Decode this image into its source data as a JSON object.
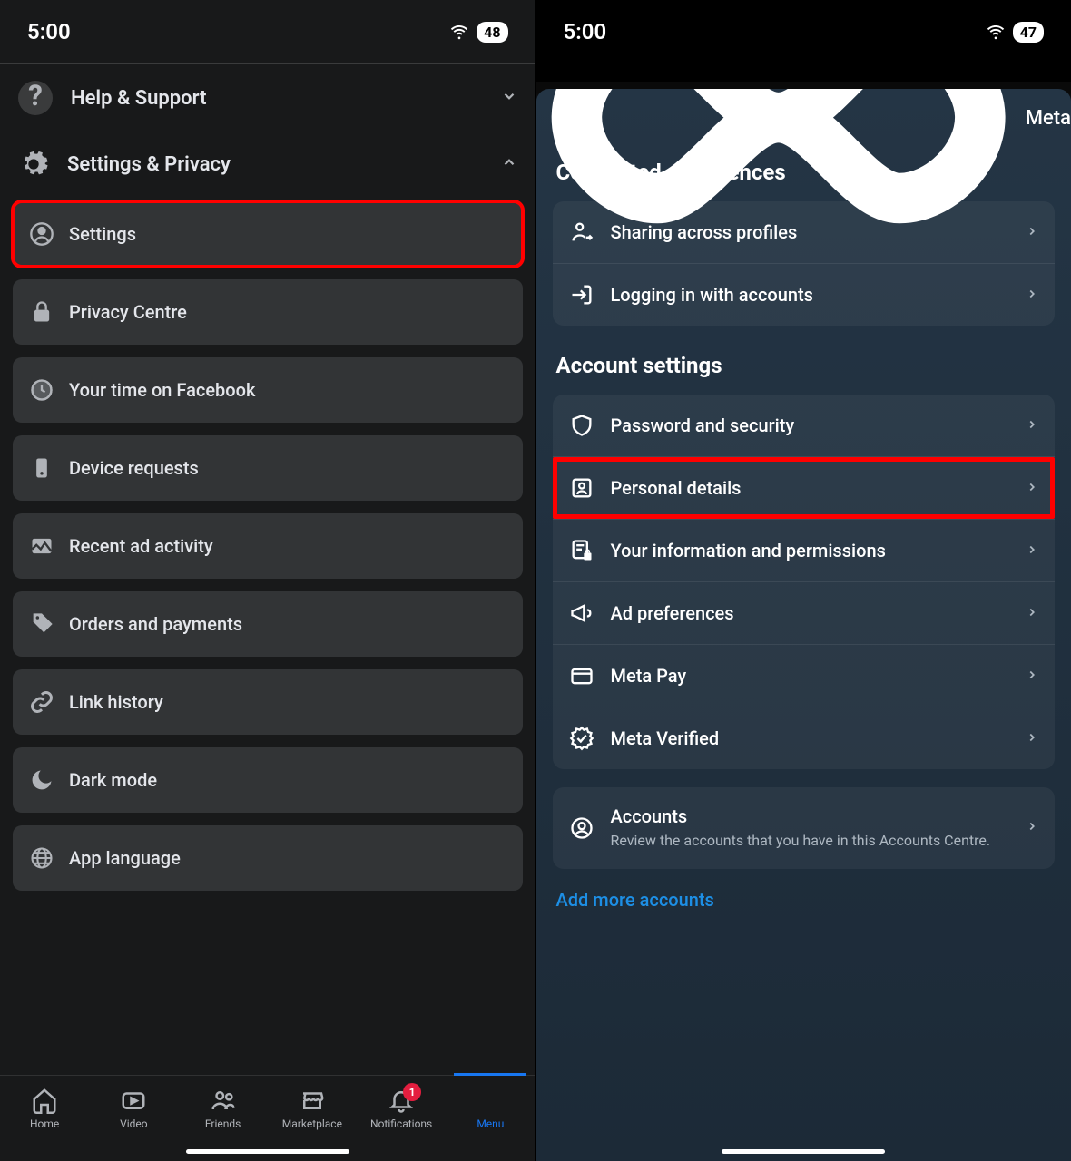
{
  "left": {
    "status": {
      "time": "5:00",
      "battery": "48"
    },
    "help_support": "Help & Support",
    "settings_privacy": "Settings & Privacy",
    "items": [
      {
        "label": "Settings",
        "icon": "person-circle",
        "highlight": true
      },
      {
        "label": "Privacy Centre",
        "icon": "lock"
      },
      {
        "label": "Your time on Facebook",
        "icon": "clock"
      },
      {
        "label": "Device requests",
        "icon": "device"
      },
      {
        "label": "Recent ad activity",
        "icon": "image"
      },
      {
        "label": "Orders and payments",
        "icon": "tag"
      },
      {
        "label": "Link history",
        "icon": "link"
      },
      {
        "label": "Dark mode",
        "icon": "moon"
      },
      {
        "label": "App language",
        "icon": "globe"
      }
    ],
    "nav": {
      "home": "Home",
      "video": "Video",
      "friends": "Friends",
      "marketplace": "Marketplace",
      "notifications": "Notifications",
      "notifications_badge": "1",
      "menu": "Menu"
    }
  },
  "right": {
    "status": {
      "time": "5:00",
      "battery": "47"
    },
    "brand": "Meta",
    "connected_title": "Connected experiences",
    "connected_items": [
      {
        "label": "Sharing across profiles",
        "icon": "share-user"
      },
      {
        "label": "Logging in with accounts",
        "icon": "login-arrow"
      }
    ],
    "account_settings_title": "Account settings",
    "account_items": [
      {
        "label": "Password and security",
        "icon": "shield"
      },
      {
        "label": "Personal details",
        "icon": "id-card",
        "highlight": true
      },
      {
        "label": "Your information and permissions",
        "icon": "doc-lock"
      },
      {
        "label": "Ad preferences",
        "icon": "megaphone"
      },
      {
        "label": "Meta Pay",
        "icon": "credit-card"
      },
      {
        "label": "Meta Verified",
        "icon": "verified"
      }
    ],
    "accounts": {
      "label": "Accounts",
      "sub": "Review the accounts that you have in this Accounts Centre."
    },
    "add_more": "Add more accounts"
  }
}
